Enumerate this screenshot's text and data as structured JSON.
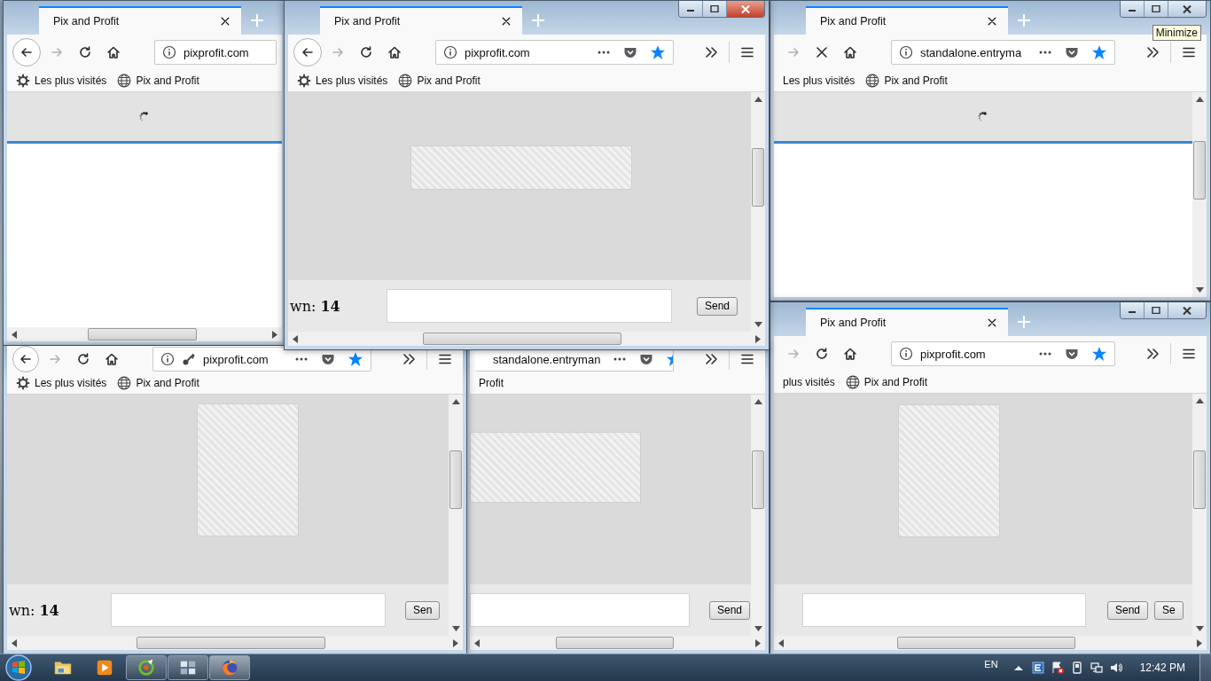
{
  "windows": [
    {
      "tab": {
        "title": "Pix and Profit",
        "selected": true
      },
      "nav": [
        {
          "kind": "back",
          "disabled": false
        },
        {
          "kind": "forward",
          "disabled": true
        },
        {
          "kind": "reload",
          "disabled": false
        },
        {
          "kind": "home",
          "disabled": false
        }
      ],
      "url": {
        "icons": [
          {
            "kind": "info"
          }
        ],
        "text": "pixprofit.com"
      },
      "bookmarks": [
        {
          "label": "Les plus visités",
          "kind": "gear"
        },
        {
          "label": "Pix and Profit",
          "kind": "globe"
        }
      ],
      "content": {
        "kind": "loading",
        "scrollbars": [
          {
            "kind": "horizontal"
          }
        ]
      }
    },
    {
      "tab": {
        "title": "Pix and Profit",
        "selected": true
      },
      "frame_buttons": [
        {
          "kind": "minimize"
        },
        {
          "kind": "maximize"
        },
        {
          "kind": "close"
        }
      ],
      "active": true,
      "nav": [
        {
          "kind": "back",
          "disabled": false
        },
        {
          "kind": "forward",
          "disabled": true
        },
        {
          "kind": "reload",
          "disabled": false
        },
        {
          "kind": "home",
          "disabled": false
        }
      ],
      "url": {
        "icons": [
          {
            "kind": "info"
          }
        ],
        "text": "pixprofit.com",
        "actions": [
          {
            "kind": "more"
          },
          {
            "kind": "pocket"
          },
          {
            "kind": "star",
            "selected": true
          }
        ]
      },
      "toolbar": [
        {
          "kind": "overflow"
        },
        {
          "kind": "menu"
        }
      ],
      "bookmarks": [
        {
          "label": "Les plus visités",
          "kind": "gear"
        },
        {
          "label": "Pix and Profit",
          "kind": "globe"
        }
      ],
      "content": {
        "kind": "captcha",
        "scrollbars": [
          {
            "kind": "vertical"
          },
          {
            "kind": "horizontal"
          }
        ],
        "counter": "wn: **14**",
        "buttons": [
          "Send"
        ]
      }
    },
    {
      "tab": {
        "title": "Pix and Profit",
        "selected": true
      },
      "frame_buttons": [
        {
          "kind": "minimize"
        },
        {
          "kind": "maximize"
        },
        {
          "kind": "close"
        }
      ],
      "active": false,
      "tooltip": "Minimize",
      "nav": [
        {
          "kind": "forward",
          "disabled": true
        },
        {
          "kind": "stop",
          "disabled": false
        },
        {
          "kind": "home",
          "disabled": false
        }
      ],
      "url": {
        "icons": [
          {
            "kind": "info"
          }
        ],
        "text": "standalone.entryma",
        "actions": [
          {
            "kind": "more"
          },
          {
            "kind": "pocket"
          },
          {
            "kind": "star",
            "selected": true
          }
        ]
      },
      "toolbar": [
        {
          "kind": "overflow"
        },
        {
          "kind": "menu"
        }
      ],
      "bookmarks": [
        {
          "label": "Les plus visités",
          "kind": "plain"
        },
        {
          "label": "Pix and Profit",
          "kind": "globe"
        }
      ],
      "content": {
        "kind": "loading",
        "scrollbars": [
          {
            "kind": "vertical"
          }
        ]
      }
    },
    {
      "nav": [
        {
          "kind": "back",
          "disabled": false
        },
        {
          "kind": "forward",
          "disabled": true
        },
        {
          "kind": "reload",
          "disabled": false
        },
        {
          "kind": "home",
          "disabled": false
        }
      ],
      "url": {
        "icons": [
          {
            "kind": "info"
          },
          {
            "kind": "key"
          }
        ],
        "text": "pixprofit.com",
        "actions": [
          {
            "kind": "more"
          },
          {
            "kind": "pocket"
          },
          {
            "kind": "star",
            "selected": true
          }
        ]
      },
      "toolbar": [
        {
          "kind": "overflow"
        },
        {
          "kind": "menu"
        }
      ],
      "bookmarks": [
        {
          "label": "Les plus visités",
          "kind": "gear"
        },
        {
          "label": "Pix and Profit",
          "kind": "globe"
        }
      ],
      "content": {
        "kind": "captcha",
        "scrollbars": [
          {
            "kind": "vertical"
          },
          {
            "kind": "horizontal"
          }
        ],
        "counter": "wn: **14**",
        "buttons": [
          "Sen"
        ]
      }
    },
    {
      "url": {
        "text": "standalone.entryman",
        "actions": [
          {
            "kind": "more"
          },
          {
            "kind": "pocket"
          },
          {
            "kind": "star",
            "selected": true
          }
        ]
      },
      "toolbar": [
        {
          "kind": "overflow"
        },
        {
          "kind": "menu"
        }
      ],
      "bookmarks": [
        {
          "label": "Profit",
          "kind": "plain"
        }
      ],
      "content": {
        "kind": "captcha",
        "scrollbars": [
          {
            "kind": "vertical"
          },
          {
            "kind": "horizontal"
          }
        ],
        "buttons": [
          "Send"
        ]
      }
    },
    {
      "tab": {
        "title": "Pix and Profit",
        "selected": true
      },
      "frame_buttons": [
        {
          "kind": "minimize"
        },
        {
          "kind": "maximize"
        },
        {
          "kind": "close"
        }
      ],
      "active": false,
      "nav": [
        {
          "kind": "forward",
          "disabled": true
        },
        {
          "kind": "reload",
          "disabled": false
        },
        {
          "kind": "home",
          "disabled": false
        }
      ],
      "url": {
        "icons": [
          {
            "kind": "info"
          }
        ],
        "text": "pixprofit.com",
        "actions": [
          {
            "kind": "more"
          },
          {
            "kind": "pocket"
          },
          {
            "kind": "star",
            "selected": true
          }
        ]
      },
      "toolbar": [
        {
          "kind": "overflow"
        },
        {
          "kind": "menu"
        }
      ],
      "bookmarks": [
        {
          "label": "plus visités",
          "kind": "plain"
        },
        {
          "label": "Pix and Profit",
          "kind": "globe"
        }
      ],
      "content": {
        "kind": "captcha",
        "scrollbars": [
          {
            "kind": "vertical"
          },
          {
            "kind": "horizontal"
          }
        ],
        "buttons": [
          "Send",
          "Se"
        ]
      }
    }
  ],
  "taskbar": {
    "apps": [
      {
        "kind": "folder",
        "running": false,
        "active": false
      },
      {
        "kind": "media",
        "running": false,
        "active": false
      },
      {
        "kind": "green_app",
        "running": true,
        "active": false
      },
      {
        "kind": "panel_app",
        "running": true,
        "active": false
      },
      {
        "kind": "browser",
        "running": true,
        "active": true
      }
    ],
    "language": "EN",
    "tray": [
      {
        "kind": "chevron"
      },
      {
        "kind": "note"
      },
      {
        "kind": "flag_alert"
      },
      {
        "kind": "device"
      },
      {
        "kind": "network"
      },
      {
        "kind": "volume"
      }
    ],
    "clock": "12:42 PM"
  }
}
